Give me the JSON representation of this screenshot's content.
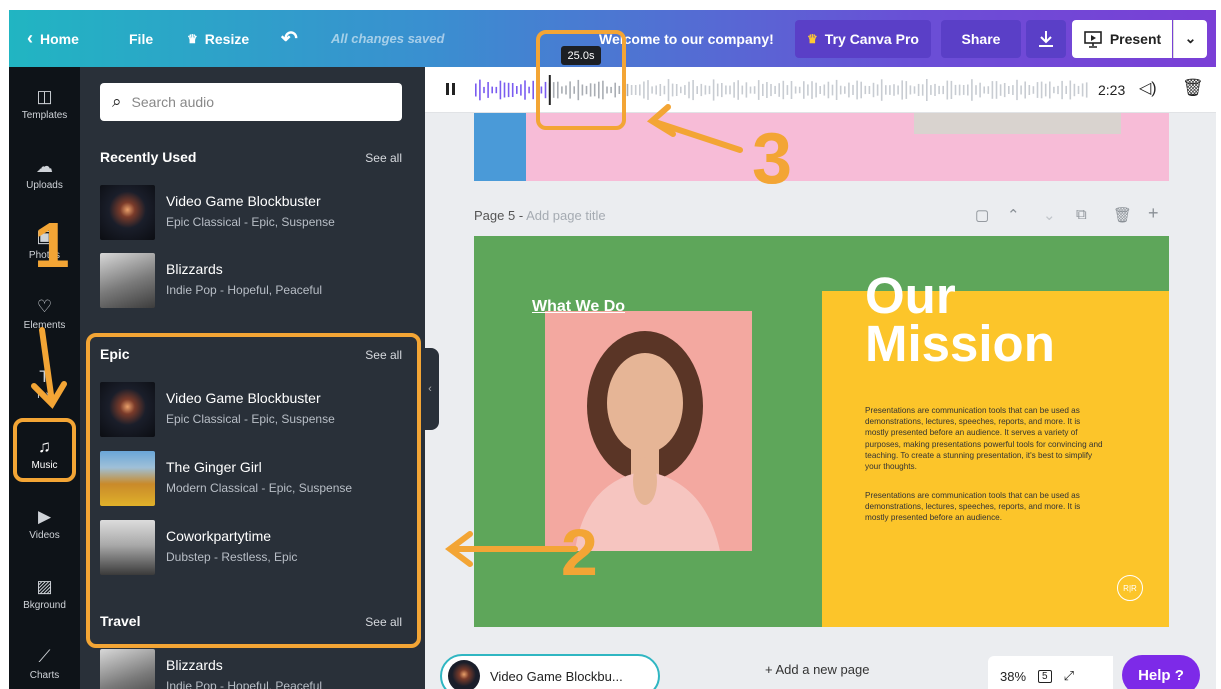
{
  "topbar": {
    "home_label": "Home",
    "file_label": "File",
    "resize_label": "Resize",
    "saved_status": "All changes saved",
    "design_title": "Welcome to our company!",
    "pro_label": "Try Canva Pro",
    "share_label": "Share",
    "present_label": "Present"
  },
  "rail": {
    "items": [
      {
        "label": "Templates",
        "icon": "templates-icon"
      },
      {
        "label": "Uploads",
        "icon": "upload-icon"
      },
      {
        "label": "Photos",
        "icon": "photo-icon"
      },
      {
        "label": "Elements",
        "icon": "elements-icon"
      },
      {
        "label": "Text",
        "icon": "text-icon"
      },
      {
        "label": "Music",
        "icon": "music-icon"
      },
      {
        "label": "Videos",
        "icon": "video-icon"
      },
      {
        "label": "Bkground",
        "icon": "background-icon"
      },
      {
        "label": "Charts",
        "icon": "charts-icon"
      }
    ]
  },
  "panel": {
    "search_placeholder": "Search audio",
    "see_all": "See all",
    "recent": {
      "title": "Recently Used",
      "tracks": [
        {
          "name": "Video Game Blockbuster",
          "sub": "Epic Classical - Epic, Suspense"
        },
        {
          "name": "Blizzards",
          "sub": "Indie Pop - Hopeful, Peaceful"
        }
      ]
    },
    "epic": {
      "title": "Epic",
      "tracks": [
        {
          "name": "Video Game Blockbuster",
          "sub": "Epic Classical - Epic, Suspense"
        },
        {
          "name": "The Ginger Girl",
          "sub": "Modern Classical - Epic, Suspense"
        },
        {
          "name": "Coworkpartytime",
          "sub": "Dubstep - Restless, Epic"
        }
      ]
    },
    "travel": {
      "title": "Travel",
      "tracks": [
        {
          "name": "Blizzards",
          "sub": "Indie Pop - Hopeful, Peaceful"
        }
      ]
    }
  },
  "audio": {
    "tooltip": "25.0s",
    "duration": "2:23",
    "playhead_fraction": 0.12
  },
  "page5": {
    "label": "Page 5 -",
    "title_placeholder": "Add page title",
    "what_we_do": "What We Do",
    "heading_line1": "Our",
    "heading_line2": "Mission",
    "paragraph1": "Presentations are communication tools that can be used as demonstrations, lectures, speeches, reports, and more. It is mostly presented before an audience. It serves a variety of purposes, making presentations powerful tools for convincing and teaching. To create a stunning presentation, it's best to simplify your thoughts.",
    "paragraph2": "Presentations are communication tools that can be used as demonstrations, lectures, speeches, reports, and more. It is mostly presented before an audience.",
    "logo_text": "R|R"
  },
  "bottom": {
    "now_playing": "Video Game Blockbu...",
    "add_page": "+ Add a new page",
    "zoom": "38%",
    "page_count": "5",
    "help_label": "Help ?"
  },
  "annotations": {
    "n1": "1",
    "n2": "2",
    "n3": "3"
  },
  "colors": {
    "accent_orange": "#f3a535",
    "panel_bg": "#293039",
    "slide_green": "#5ea65a",
    "slide_yellow": "#fcc52a",
    "help_purple": "#7d2ae8"
  }
}
